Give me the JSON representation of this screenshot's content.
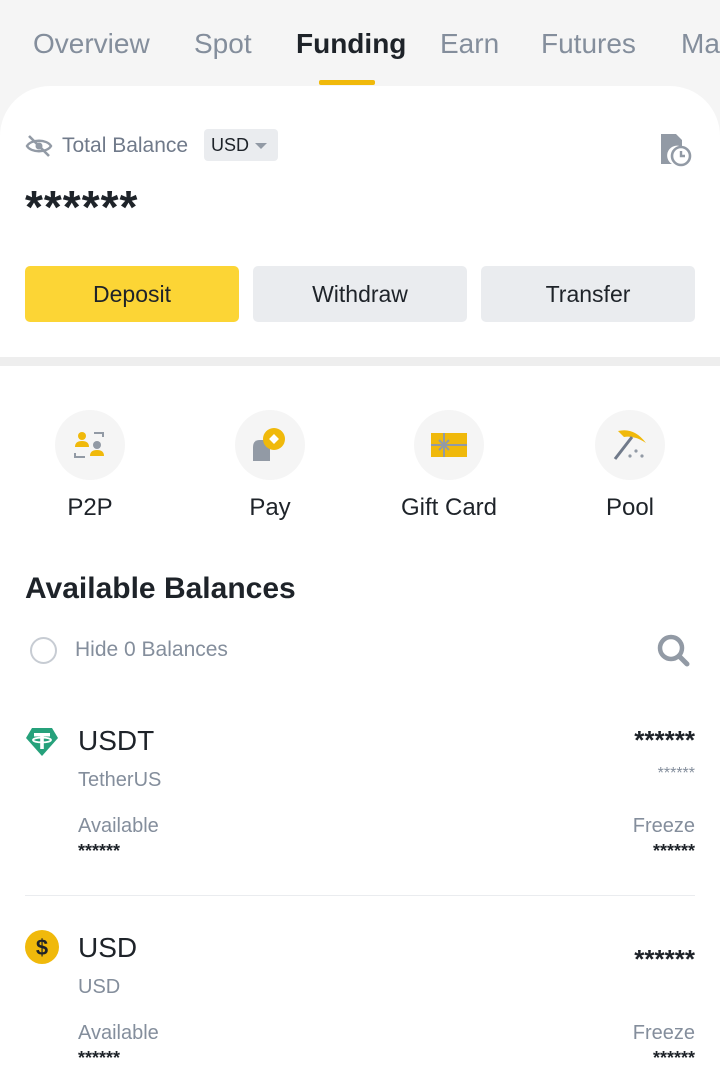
{
  "tabs": [
    {
      "label": "Overview"
    },
    {
      "label": "Spot"
    },
    {
      "label": "Funding"
    },
    {
      "label": "Earn"
    },
    {
      "label": "Futures"
    },
    {
      "label": "Ma"
    }
  ],
  "active_tab": "Funding",
  "balance": {
    "label": "Total Balance",
    "currency": "USD",
    "value": "******",
    "visibility_icon": "eye-hidden-icon",
    "history_icon": "document-history-icon"
  },
  "actions": {
    "deposit": "Deposit",
    "withdraw": "Withdraw",
    "transfer": "Transfer"
  },
  "services": [
    {
      "label": "P2P",
      "icon": "p2p-icon"
    },
    {
      "label": "Pay",
      "icon": "pay-icon"
    },
    {
      "label": "Gift Card",
      "icon": "gift-card-icon"
    },
    {
      "label": "Pool",
      "icon": "pool-pickaxe-icon"
    }
  ],
  "available": {
    "title": "Available Balances",
    "hide_zero_label": "Hide 0 Balances"
  },
  "assets": [
    {
      "symbol": "USDT",
      "name": "TetherUS",
      "icon": "tether-icon",
      "total": "******",
      "usd_value": "******",
      "available_label": "Available",
      "available": "******",
      "freeze_label": "Freeze",
      "freeze": "******"
    },
    {
      "symbol": "USD",
      "name": "USD",
      "icon": "dollar-coin-icon",
      "total": "******",
      "available_label": "Available",
      "available": "******",
      "freeze_label": "Freeze",
      "freeze": "******"
    }
  ],
  "colors": {
    "accent": "#FCD535",
    "underline": "#F0B90B",
    "tether": "#26A17B",
    "usd_coin": "#F0B90B"
  }
}
